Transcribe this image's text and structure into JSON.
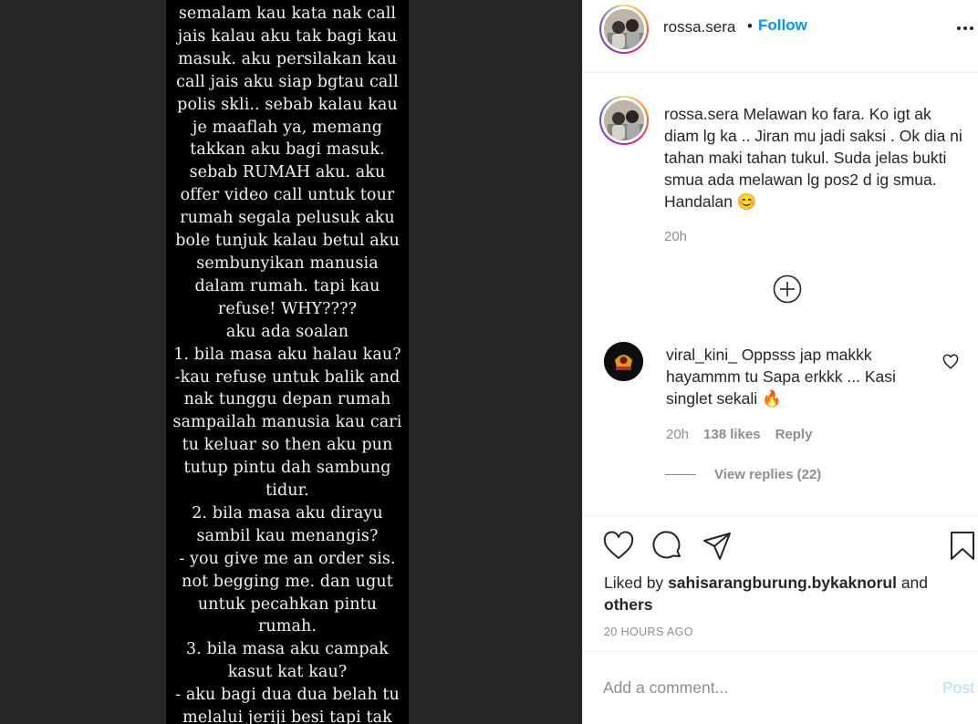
{
  "story": {
    "lines": [
      "semalam kau kata nak call",
      "jais kalau aku tak bagi kau",
      "masuk. aku persilakan kau",
      "call jais aku siap bgtau call",
      "polis skli.. sebab kalau kau",
      "je maaflah ya, memang",
      "takkan aku bagi masuk.",
      "sebab RUMAH aku. aku",
      "offer video call untuk tour",
      "rumah segala pelusuk aku",
      "bole tunjuk kalau betul aku",
      "sembunyikan manusia",
      "dalam rumah. tapi kau",
      "refuse! WHY????",
      "aku ada soalan",
      "1. bila masa aku halau kau?",
      "-kau refuse untuk balik and",
      "nak tunggu depan rumah",
      "sampailah manusia kau cari",
      "tu keluar so then aku pun",
      "tutup pintu dah sambung",
      "tidur.",
      "2. bila masa aku dirayu",
      "sambil kau menangis?",
      "- you give me an order sis.",
      "not begging me. dan ugut",
      "untuk pecahkan pintu",
      "rumah.",
      "3. bila masa aku campak",
      "kasut kat kau?",
      "- aku bagi dua dua belah tu",
      "melalui jeriji besi tapi tak"
    ]
  },
  "header": {
    "username": "rossa.sera",
    "separator": "•",
    "follow_label": "Follow",
    "more_icon": "more-horizontal-icon"
  },
  "caption": {
    "username": "rossa.sera",
    "text": "Melawan ko fara. Ko igt ak diam lg ka .. Jiran mu jadi saksi . Ok dia ni tahan maki tahan tukul. Suda jelas bukti smua ada melawan lg pos2 d ig smua. Handalan 😊",
    "time": "20h"
  },
  "load_more_icon": "plus-circle-icon",
  "comment": {
    "username": "viral_kini_",
    "text": "Oppsss jap makkk hayammm tu Sapa erkkk ... Kasi singlet sekali 🔥",
    "time": "20h",
    "likes": "138 likes",
    "reply_label": "Reply",
    "view_replies": "View replies (22)"
  },
  "actions": {
    "like_icon": "heart-icon",
    "comment_icon": "comment-icon",
    "share_icon": "send-icon",
    "save_icon": "bookmark-icon"
  },
  "likes": {
    "prefix": "Liked by",
    "user": "sahisarangburung.bykaknorul",
    "middle": "and",
    "others": "others"
  },
  "post_time": "20 HOURS AGO",
  "comment_box": {
    "placeholder": "Add a comment...",
    "post_label": "Post"
  },
  "colors": {
    "accent": "#0095f6",
    "post_disabled": "#b2dffc",
    "secondary_text": "#8e8e8e"
  }
}
